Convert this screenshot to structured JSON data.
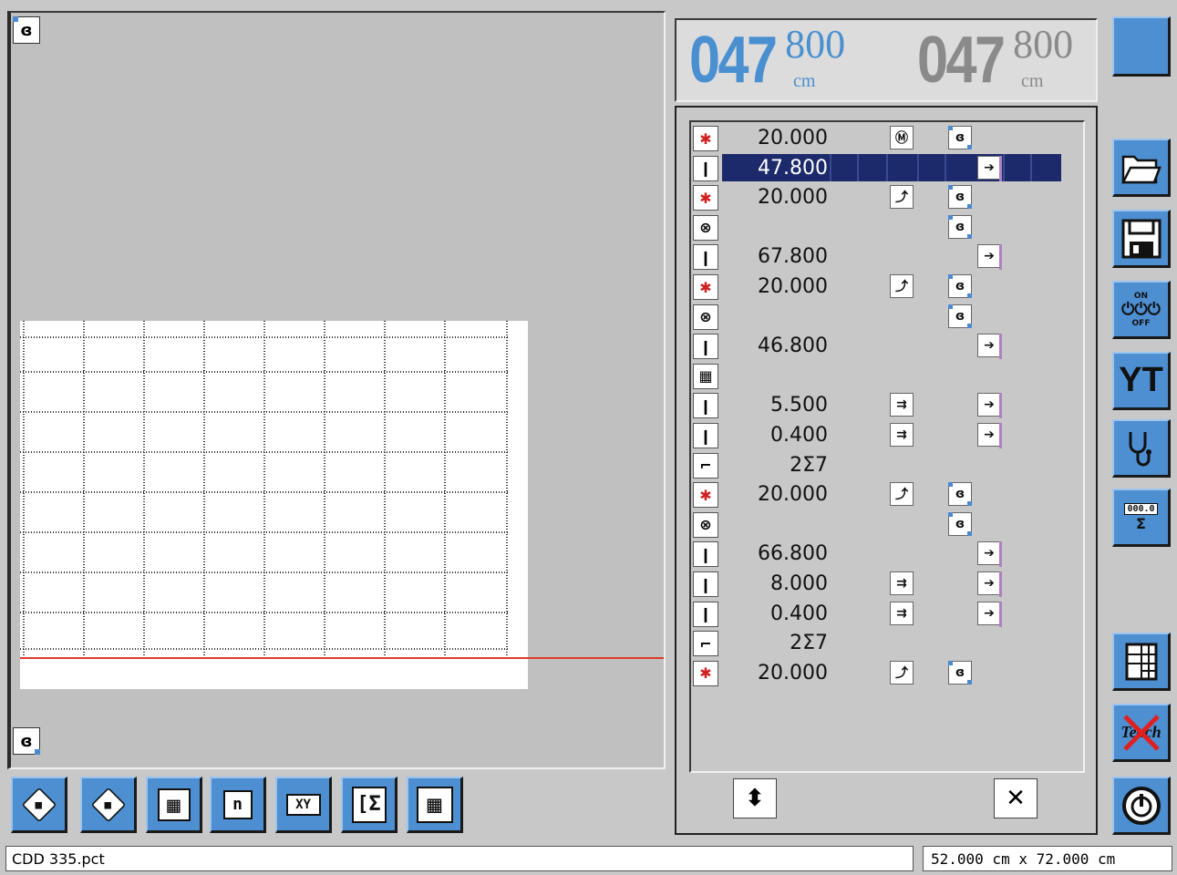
{
  "counter": {
    "left": {
      "main": "047",
      "decimal": "800",
      "unit": "cm",
      "color": "#4a8fd0"
    },
    "right": {
      "main": "047",
      "decimal": "800",
      "unit": "cm",
      "color": "#8a8a8a"
    }
  },
  "program": {
    "selected_index": 1,
    "rows": [
      {
        "op": "star-icon",
        "op_glyph": "✱",
        "value": "20.000",
        "col2": "Ⓜ",
        "col3": "ɞ"
      },
      {
        "op": "knife-icon",
        "op_glyph": "❙",
        "value": "47.800",
        "col2": "",
        "col3": "",
        "col4": "➔"
      },
      {
        "op": "star-icon",
        "op_glyph": "✱",
        "value": "20.000",
        "col2": "⤴",
        "col3": "ɞ"
      },
      {
        "op": "clamp-icon",
        "op_glyph": "⊗",
        "value": "",
        "col2": "",
        "col3": "ɞ"
      },
      {
        "op": "knife-icon",
        "op_glyph": "❙",
        "value": "67.800",
        "col2": "",
        "col3": "",
        "col4": "➔"
      },
      {
        "op": "star-icon",
        "op_glyph": "✱",
        "value": "20.000",
        "col2": "⤴",
        "col3": "ɞ"
      },
      {
        "op": "clamp-icon",
        "op_glyph": "⊗",
        "value": "",
        "col2": "",
        "col3": "ɞ"
      },
      {
        "op": "knife-icon",
        "op_glyph": "❙",
        "value": "46.800",
        "col2": "",
        "col3": "",
        "col4": "➔"
      },
      {
        "op": "grid-icon",
        "op_glyph": "▦",
        "value": "",
        "col2": "",
        "col3": ""
      },
      {
        "op": "knife-icon",
        "op_glyph": "❙",
        "value": "5.500",
        "col2": "⇉",
        "col3": "",
        "col4": "➔"
      },
      {
        "op": "knife-icon",
        "op_glyph": "❙",
        "value": "0.400",
        "col2": "⇉",
        "col3": "",
        "col4": "➔"
      },
      {
        "op": "repeat-icon",
        "op_glyph": "⌐",
        "value": "2Σ7",
        "col2": "",
        "col3": ""
      },
      {
        "op": "star-icon",
        "op_glyph": "✱",
        "value": "20.000",
        "col2": "⤴",
        "col3": "ɞ"
      },
      {
        "op": "clamp-icon",
        "op_glyph": "⊗",
        "value": "",
        "col2": "",
        "col3": "ɞ"
      },
      {
        "op": "knife-icon",
        "op_glyph": "❙",
        "value": "66.800",
        "col2": "",
        "col3": "",
        "col4": "➔"
      },
      {
        "op": "knife-icon",
        "op_glyph": "❙",
        "value": "8.000",
        "col2": "⇉",
        "col3": "",
        "col4": "➔"
      },
      {
        "op": "knife-icon",
        "op_glyph": "❙",
        "value": "0.400",
        "col2": "⇉",
        "col3": "",
        "col4": "➔"
      },
      {
        "op": "repeat-icon",
        "op_glyph": "⌐",
        "value": "2Σ7",
        "col2": "",
        "col3": ""
      },
      {
        "op": "star-icon",
        "op_glyph": "✱",
        "value": "20.000",
        "col2": "⤴",
        "col3": "ɞ"
      }
    ]
  },
  "toolbar": {
    "buttons": [
      {
        "name": "layer-down-icon",
        "glyph": "◆"
      },
      {
        "name": "layer-up-icon",
        "glyph": "◆"
      },
      {
        "name": "grid-icon",
        "glyph": "▦"
      },
      {
        "name": "cube-n-icon",
        "glyph": "n"
      },
      {
        "name": "xy-icon",
        "glyph": "XY"
      },
      {
        "name": "sum-bracket-icon",
        "glyph": "[Σ"
      },
      {
        "name": "grid-resize-icon",
        "glyph": "▦"
      }
    ]
  },
  "sidebar": {
    "teach_label": "Teach",
    "onoff_on": "ON",
    "onoff_off": "OFF",
    "yt_label": "YT",
    "counter_label": "000.0",
    "sigma": "Σ"
  },
  "status": {
    "filename": "CDD 335.pct",
    "dimensions": "52.000 cm x  72.000 cm"
  },
  "scroll": {
    "up_glyph": "⬍",
    "down_glyph": "✕"
  },
  "colors": {
    "accent": "#4d8fd1",
    "selection": "#1c2a6c",
    "red_line": "#e03a2a"
  }
}
